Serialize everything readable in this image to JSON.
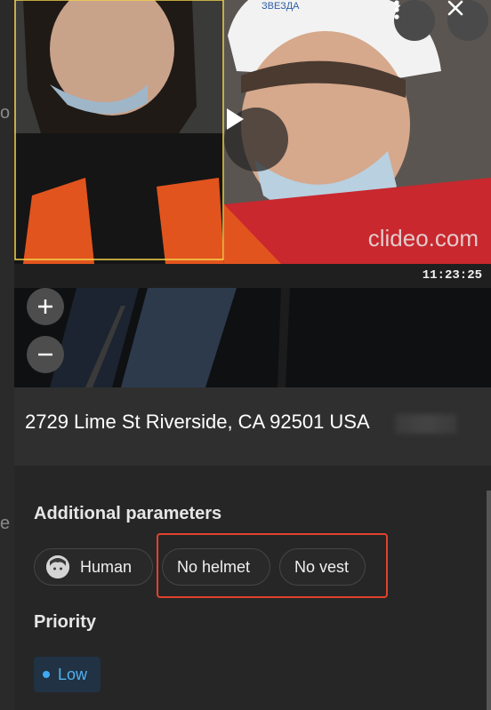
{
  "left_edge": {
    "fragments": [
      "o",
      "e"
    ]
  },
  "video": {
    "watermark": "clideo.com",
    "helmet_text": "ЗВЕЗДА",
    "timestamp": "11:23:25"
  },
  "location": {
    "address": "2729 Lime St Riverside, CA 92501 USA"
  },
  "additional_parameters": {
    "title": "Additional parameters",
    "chips": [
      {
        "label": "Human",
        "icon": "human-face-icon"
      },
      {
        "label": "No helmet"
      },
      {
        "label": "No vest"
      }
    ]
  },
  "priority": {
    "title": "Priority",
    "value": "Low",
    "color": "#3fa9f5"
  },
  "colors": {
    "highlight_frame": "#e2412c",
    "detection_box": "#f3d54a"
  }
}
